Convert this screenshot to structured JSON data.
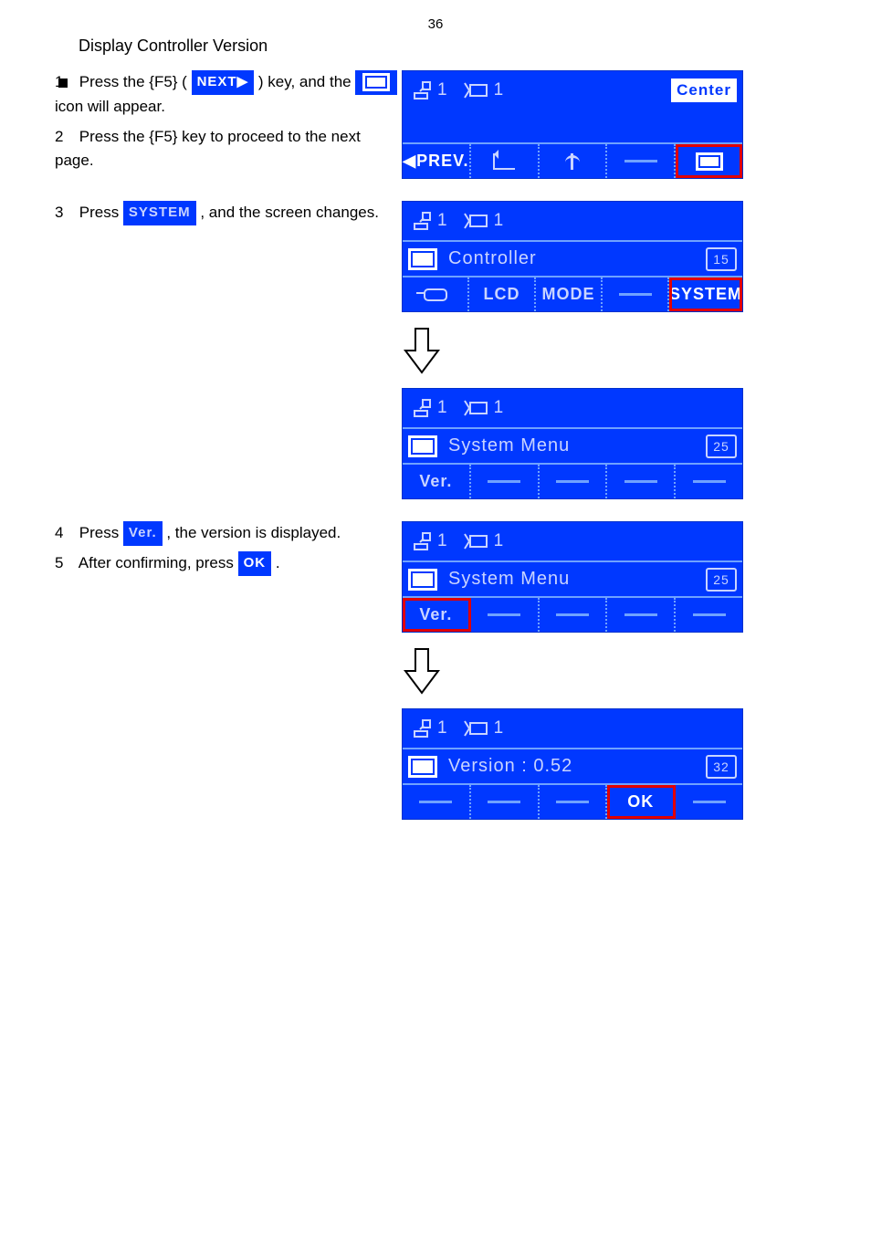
{
  "page_number": "36",
  "section_title": "Display Controller Version",
  "steps": [
    {
      "number": "1",
      "parts": [
        {
          "t": "Press the {F5} ("
        },
        {
          "chip": "NEXT▶"
        },
        {
          "t": ") key, and the "
        },
        {
          "chip_icon": "monitor"
        },
        {
          "t": " icon will appear."
        }
      ]
    },
    {
      "number": "2",
      "parts": [
        {
          "t": "Press the {F5} key to proceed to the next page."
        }
      ]
    },
    {
      "number": "3",
      "parts": [
        {
          "t": "Press "
        },
        {
          "chip_light": "SYSTEM"
        },
        {
          "t": ", and the screen changes."
        }
      ]
    },
    {
      "number": "4",
      "parts": [
        {
          "t": "Press "
        },
        {
          "chip_light": "Ver."
        },
        {
          "t": ", the version is displayed."
        }
      ]
    },
    {
      "number": "5",
      "parts": [
        {
          "t": "After confirming, press "
        },
        {
          "chip": "OK"
        },
        {
          "t": "."
        }
      ]
    }
  ],
  "labels": {
    "center": "Center",
    "prev": "◀PREV.",
    "system": "SYSTEM",
    "controller": "Controller",
    "lcd": "LCD",
    "mode": "MODE",
    "system_menu": "System Menu",
    "ver": "Ver.",
    "version_val": "Version : 0.52",
    "ok": "OK",
    "code15": "15",
    "code25": "25",
    "code32": "32",
    "status_a": "1",
    "status_b": "1"
  }
}
